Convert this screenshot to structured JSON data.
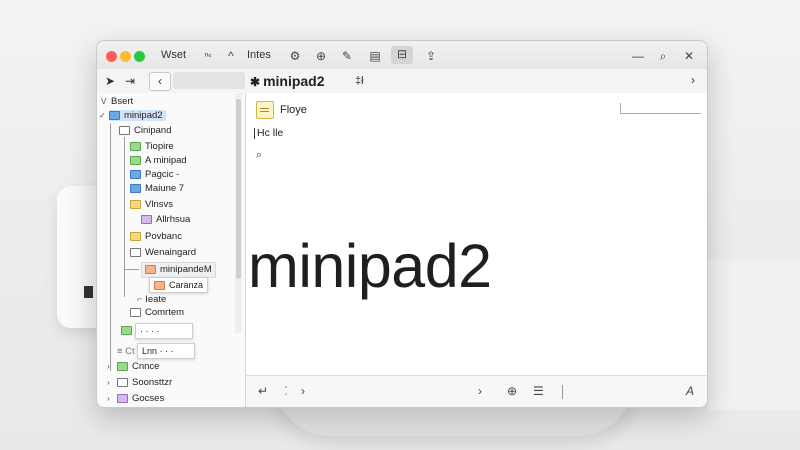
{
  "window": {
    "menu": [
      "Wset",
      "Intes"
    ],
    "nav_btns": [
      "←",
      "⇥",
      "⇤",
      "⊕"
    ],
    "tab_title": "minipad2",
    "tab_icon": "✱",
    "tab_extra": "‡ł",
    "chevron": "›"
  },
  "sidebar": {
    "items": [
      {
        "label": "Bsert"
      },
      {
        "label": "minipad2"
      },
      {
        "label": "Cinipand"
      },
      {
        "label": "Tiopire"
      },
      {
        "label": "A minipad"
      },
      {
        "label": "Pagcic -"
      },
      {
        "label": "Maiune 7"
      },
      {
        "label": "Vlnsvs"
      },
      {
        "label": "Allrhsua"
      },
      {
        "label": "Povbanc"
      },
      {
        "label": "Wenaingard"
      },
      {
        "label": "minipandeM"
      },
      {
        "label": "Caranza"
      },
      {
        "label": "Ieate"
      },
      {
        "label": "Comrtem"
      },
      {
        "label": "· · · ·"
      },
      {
        "label": "Lnn · · ·"
      },
      {
        "label": "Cnnce"
      },
      {
        "label": "Soonsttzr"
      },
      {
        "label": "Gocses"
      }
    ],
    "small_text": "≡ Ct"
  },
  "content": {
    "page_title": "Floye",
    "hello_text": "Hc lle",
    "big_title": "minipad2"
  },
  "bottombar": {
    "left": "↵",
    "dots": "⁚",
    "arrow_r1": "›",
    "arrow_r2": "›",
    "settings": "⊕",
    "menu": "☰",
    "font": "A"
  }
}
